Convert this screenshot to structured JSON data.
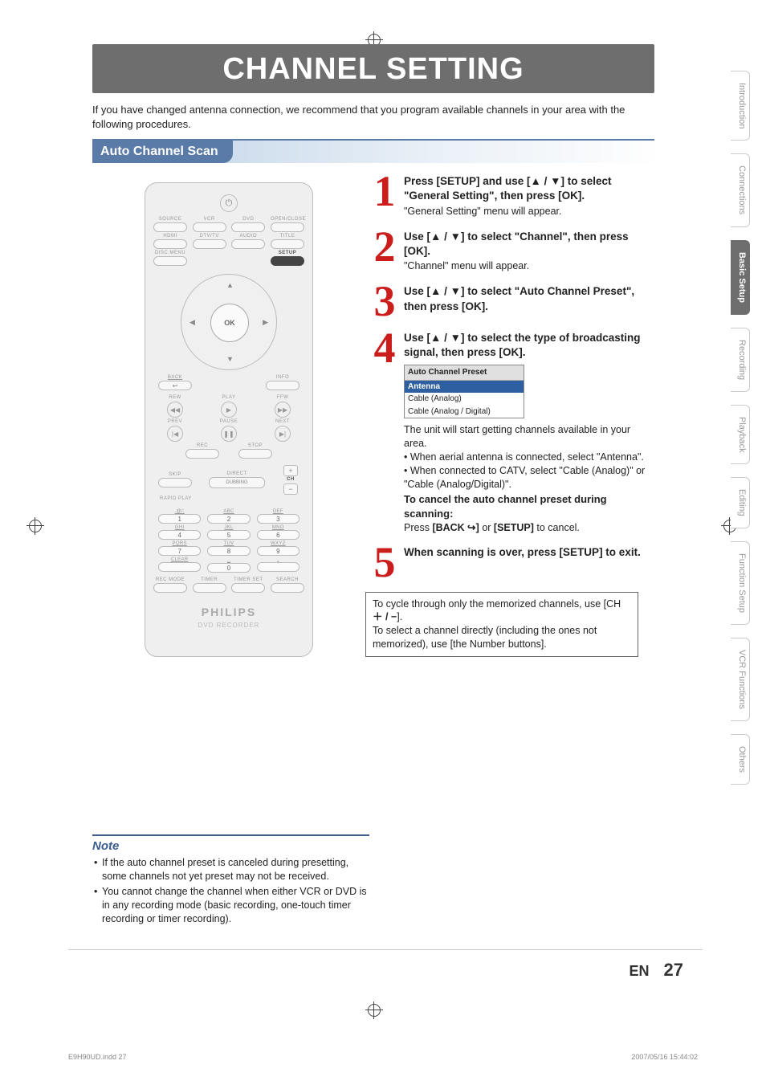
{
  "title": "CHANNEL SETTING",
  "intro": "If you have changed antenna connection, we recommend that you program available channels in your area with the following procedures.",
  "section_heading": "Auto Channel Scan",
  "side_tabs": [
    {
      "label": "Introduction",
      "active": false
    },
    {
      "label": "Connections",
      "active": false
    },
    {
      "label": "Basic Setup",
      "active": true
    },
    {
      "label": "Recording",
      "active": false
    },
    {
      "label": "Playback",
      "active": false
    },
    {
      "label": "Editing",
      "active": false
    },
    {
      "label": "Function Setup",
      "active": false
    },
    {
      "label": "VCR Functions",
      "active": false
    },
    {
      "label": "Others",
      "active": false
    }
  ],
  "steps": {
    "s1": {
      "num": "1",
      "title_a": "Press [SETUP] and use [",
      "title_b": "] to select \"General Setting\", then press [OK].",
      "sub": "\"General Setting\" menu will appear."
    },
    "s2": {
      "num": "2",
      "title_a": "Use [",
      "title_b": "] to select \"Channel\", then press [OK].",
      "sub": "\"Channel\" menu will appear."
    },
    "s3": {
      "num": "3",
      "title_a": "Use [",
      "title_b": "] to select \"Auto Channel Preset\", then press [OK]."
    },
    "s4": {
      "num": "4",
      "title_a": "Use [",
      "title_b": "] to select the type of broadcasting signal, then press [OK].",
      "menu": {
        "title": "Auto Channel Preset",
        "opts": [
          {
            "label": "Antenna",
            "selected": true
          },
          {
            "label": "Cable (Analog)",
            "selected": false
          },
          {
            "label": "Cable (Analog / Digital)",
            "selected": false
          }
        ]
      },
      "after1": "The unit will start getting channels available in your area.",
      "bullet1": "When aerial antenna is connected, select \"Antenna\".",
      "bullet2": "When connected to CATV, select \"Cable (Analog)\" or \"Cable (Analog/Digital)\".",
      "cancel_title": "To cancel the auto channel preset during scanning:",
      "cancel_text_a": "Press ",
      "cancel_back": "[BACK ",
      "cancel_back_icon": "↩",
      "cancel_back_close": "]",
      "cancel_text_b": " or ",
      "cancel_setup": "[SETUP]",
      "cancel_text_c": " to cancel."
    },
    "s5": {
      "num": "5",
      "title": "When scanning is over, press [SETUP] to exit."
    }
  },
  "tips": {
    "line1_a": "To cycle through only the memorized channels, use ",
    "line1_b": "[CH ",
    "line1_pm": "＋ / −",
    "line1_c": "]",
    "line1_d": ".",
    "line2_a": "To select a channel directly (including the ones not memorized), use ",
    "line2_b": "[the Number buttons]",
    "line2_c": "."
  },
  "note": {
    "title": "Note",
    "items": [
      "If the auto channel preset is canceled during presetting, some channels not yet preset may not be received.",
      "You cannot change the channel when either VCR or DVD is in any recording mode (basic recording, one-touch timer recording or timer recording)."
    ]
  },
  "remote": {
    "row1": [
      "SOURCE",
      "VCR",
      "DVD",
      "OPEN/CLOSE"
    ],
    "row2": [
      "HDMI",
      "DTV/TV",
      "AUDIO",
      "TITLE"
    ],
    "row3_left": "DISC MENU",
    "row3_right": "SETUP",
    "ok": "OK",
    "back": "BACK",
    "info": "INFO",
    "play_row": [
      "REW",
      "PLAY",
      "FFW"
    ],
    "play_row2": [
      "PREV",
      "PAUSE",
      "NEXT"
    ],
    "rec_stop": [
      "REC",
      "STOP"
    ],
    "skip": "SKIP",
    "direct": "DIRECT",
    "dubbing": "DUBBING",
    "rapid": "RAPID PLAY",
    "ch": "CH",
    "numpad": [
      {
        "t": ".@/:",
        "n": "1"
      },
      {
        "t": "ABC",
        "n": "2"
      },
      {
        "t": "DEF",
        "n": "3"
      },
      {
        "t": "GHI",
        "n": "4"
      },
      {
        "t": "JKL",
        "n": "5"
      },
      {
        "t": "MNO",
        "n": "6"
      },
      {
        "t": "PQRS",
        "n": "7"
      },
      {
        "t": "TUV",
        "n": "8"
      },
      {
        "t": "WXYZ",
        "n": "9"
      },
      {
        "t": "CLEAR",
        "n": ""
      },
      {
        "t": "␣",
        "n": "0"
      },
      {
        "t": ".",
        "n": ""
      }
    ],
    "bottom_row": [
      "REC MODE",
      "TIMER",
      "TIMER SET",
      "SEARCH"
    ],
    "brand": "PHILIPS",
    "subbrand": "DVD RECORDER"
  },
  "arrows": "▲ / ▼",
  "page_number": {
    "lang": "EN",
    "num": "27"
  },
  "footer": {
    "left": "E9H90UD.indd   27",
    "right": "2007/05/16   15:44:02"
  }
}
